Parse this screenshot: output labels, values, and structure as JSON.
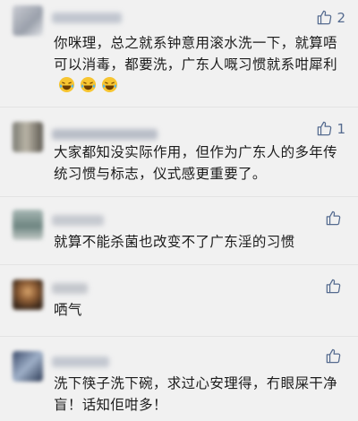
{
  "comments": [
    {
      "likes": "2",
      "text": "你咪理，总之就系钟意用滚水洗一下，就算唔可以消毒，都要洗，广东人嘅习惯就系咁犀利",
      "emojis": [
        "laugh-cry-emoji",
        "laugh-cry-emoji",
        "laugh-cry-emoji"
      ]
    },
    {
      "likes": "1",
      "text": "大家都知没实际作用，但作为广东人的多年传统习惯与标志，仪式感更重要了。"
    },
    {
      "likes": "",
      "text": "就算不能杀菌也改变不了广东淫的习惯"
    },
    {
      "likes": "",
      "text": "哂气"
    },
    {
      "likes": "",
      "text": "洗下筷子洗下碗，求过心安理得，冇眼屎干净盲！话知佢咁多！"
    }
  ],
  "colors": {
    "background": "#f1f1f1",
    "text": "#1c1c1c",
    "like_icon": "#556b8f"
  }
}
